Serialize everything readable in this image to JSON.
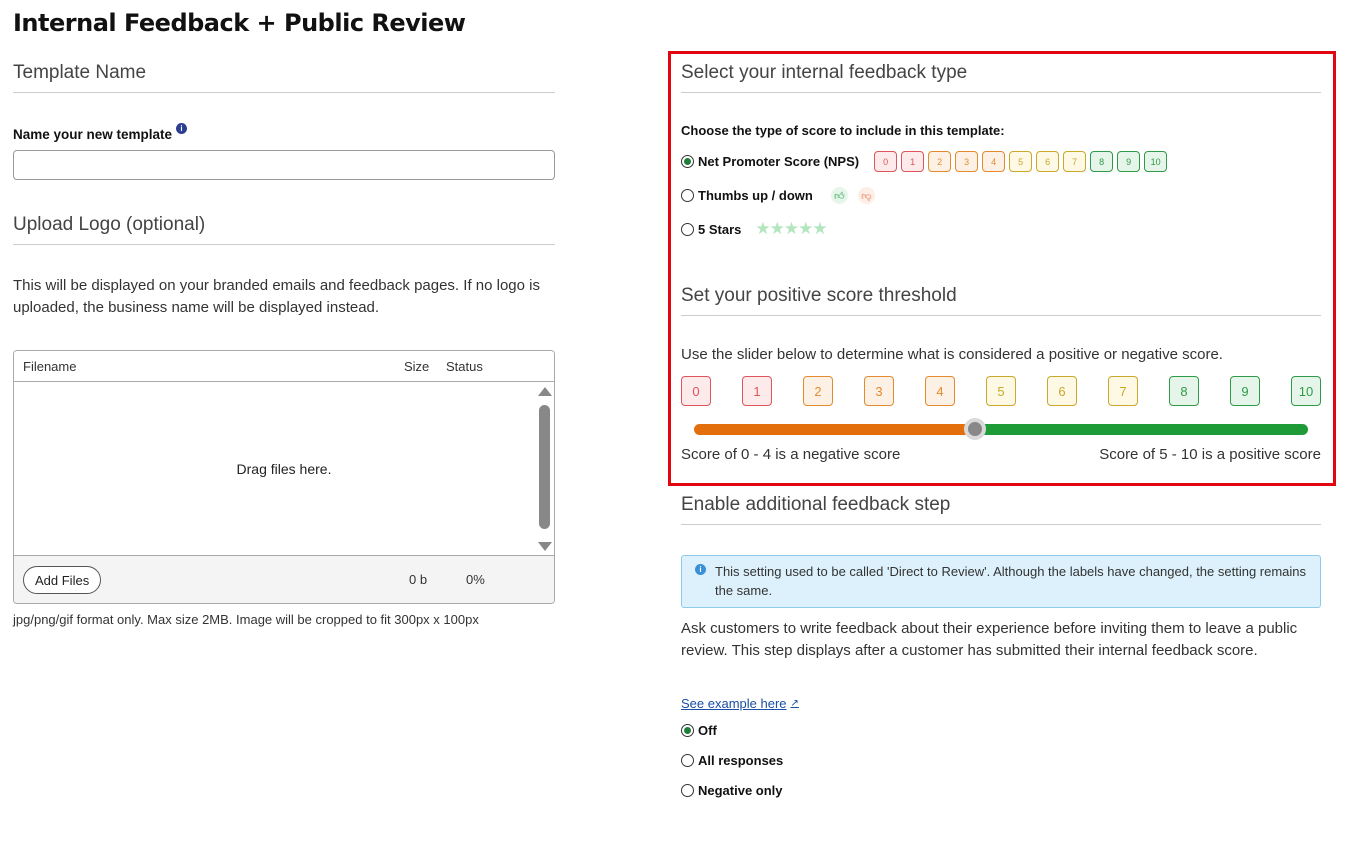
{
  "page_title": "Internal Feedback + Public Review",
  "template": {
    "heading": "Template Name",
    "name_label": "Name your new template",
    "info_icon": "info-icon",
    "name_value": ""
  },
  "logo": {
    "heading": "Upload Logo (optional)",
    "description": "This will be displayed on your branded emails and feedback pages. If no logo is uploaded, the business name will be displayed instead.",
    "columns": [
      "Filename",
      "Size",
      "Status"
    ],
    "drop_text": "Drag files here.",
    "add_files_label": "Add Files",
    "total_size": "0 b",
    "total_percent": "0%",
    "note": "jpg/png/gif format only. Max size 2MB. Image will be cropped to fit 300px x 100px"
  },
  "feedback_type": {
    "heading": "Select your internal feedback type",
    "choose_label": "Choose the type of score to include in this template:",
    "options": [
      {
        "label": "Net Promoter Score (NPS)",
        "selected": true
      },
      {
        "label": "Thumbs up / down",
        "selected": false
      },
      {
        "label": "5 Stars",
        "selected": false
      }
    ],
    "nps_scores": [
      "0",
      "1",
      "2",
      "3",
      "4",
      "5",
      "6",
      "7",
      "8",
      "9",
      "10"
    ],
    "stars": "★★★★★"
  },
  "threshold": {
    "heading": "Set your positive score threshold",
    "description": "Use the slider below to determine what is considered a positive or negative score.",
    "scores": [
      "0",
      "1",
      "2",
      "3",
      "4",
      "5",
      "6",
      "7",
      "8",
      "9",
      "10"
    ],
    "slider_value": 4,
    "negative_label": "Score of 0 - 4 is a negative score",
    "positive_label": "Score of 5 - 10 is a positive score"
  },
  "score_colors": {
    "red": "#e0555b",
    "orange": "#e38b2e",
    "yellow": "#c9a82a",
    "green": "#2f9a48"
  },
  "additional": {
    "heading": "Enable additional feedback step",
    "notice": "This setting used to be called 'Direct to Review'. Although the labels have changed, the setting remains the same.",
    "description": "Ask customers to write feedback about their experience before inviting them to leave a public review. This step displays after a customer has submitted their internal feedback score.",
    "example_link": "See example here",
    "options": [
      {
        "label": "Off",
        "selected": true
      },
      {
        "label": "All responses",
        "selected": false
      },
      {
        "label": "Negative only",
        "selected": false
      }
    ]
  }
}
